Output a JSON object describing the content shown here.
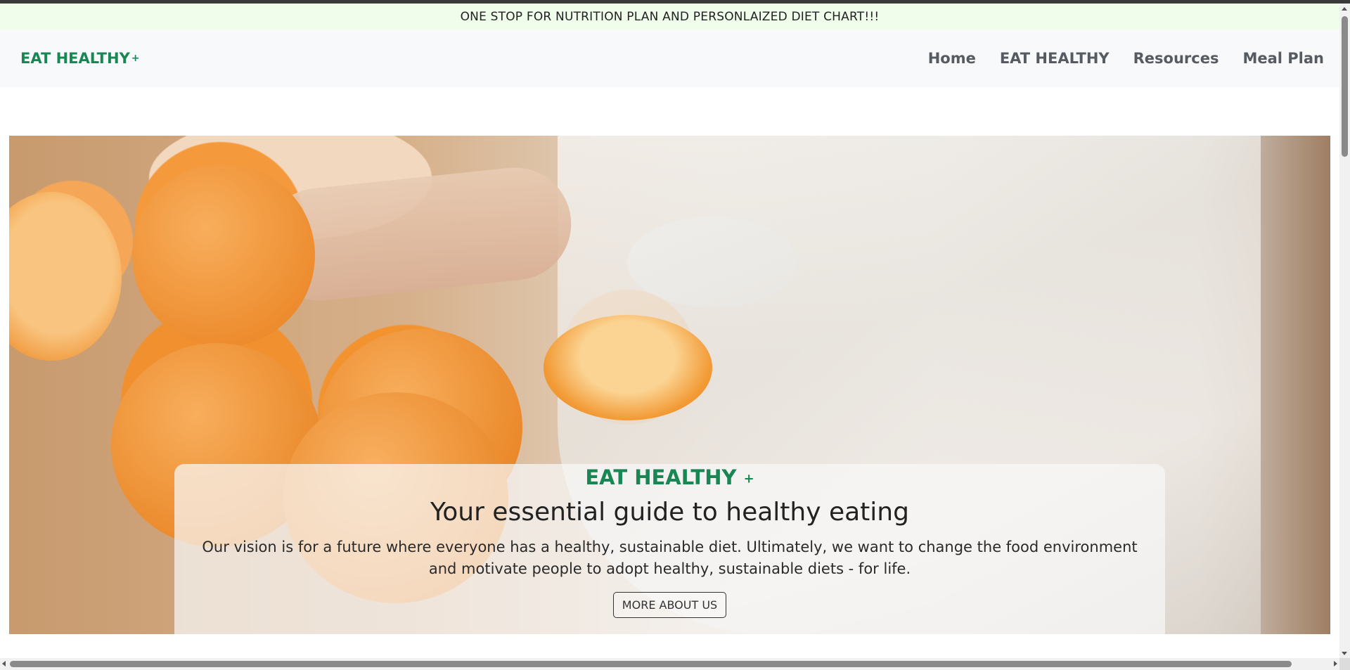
{
  "announcement": "ONE STOP FOR NUTRITION PLAN AND PERSONLAIZED DIET CHART!!!",
  "navbar": {
    "brand": "EAT HEALTHY",
    "brand_plus": "+",
    "links": [
      {
        "label": "Home"
      },
      {
        "label": "EAT HEALTHY"
      },
      {
        "label": "Resources"
      },
      {
        "label": "Meal Plan"
      }
    ]
  },
  "hero": {
    "image_description_icon": "oranges-photo",
    "caption": {
      "title": "EAT HEALTHY",
      "title_plus": "+",
      "heading": "Your essential guide to healthy eating",
      "text": "Our vision is for a future where everyone has a healthy, sustainable diet. Ultimately, we want to change the food environment and motivate people to adopt healthy, sustainable diets - for life.",
      "button_label": "MORE ABOUT US"
    }
  },
  "colors": {
    "brand_green": "#198754",
    "announcement_bg": "#f0fdea",
    "navbar_bg": "#f8f9fa",
    "nav_link": "#555b61"
  }
}
